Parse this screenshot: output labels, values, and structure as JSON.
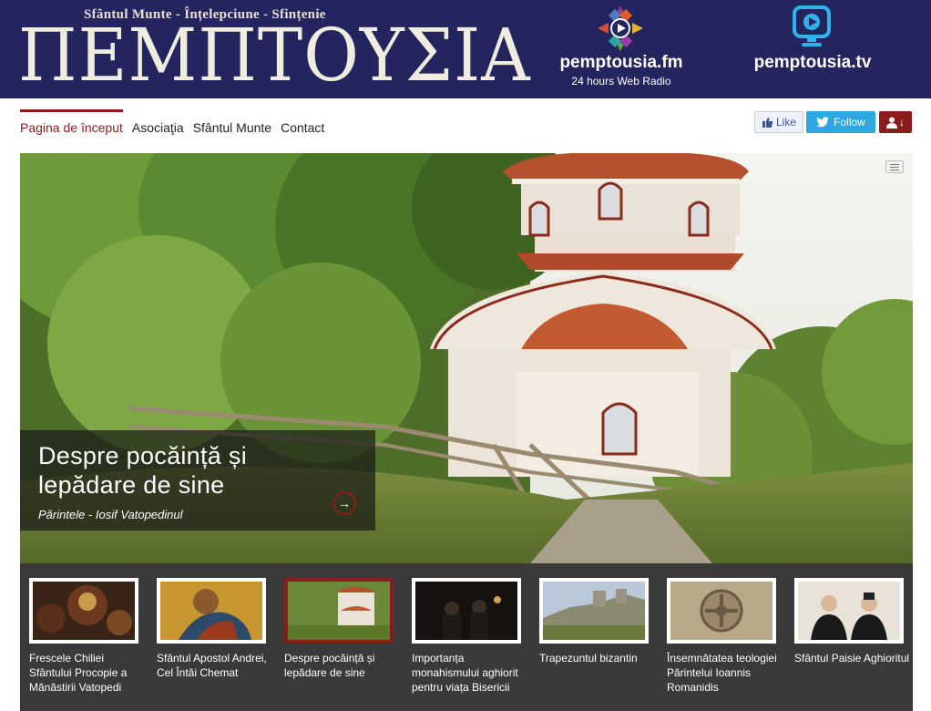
{
  "header": {
    "tagline": "Sfântul Munte - Înțelepciune - Sfințenie",
    "logo_text": "ΠΕΜΠΤΟΥΣΙΑ",
    "radio": {
      "name": "pemptousia.fm",
      "subtitle": "24 hours Web Radio",
      "icon": "radio-play-icon"
    },
    "tv": {
      "name": "pemptousia.tv",
      "icon": "tv-play-icon"
    },
    "background": "#24245e"
  },
  "nav": {
    "items": [
      {
        "label": "Pagina de început",
        "active": true
      },
      {
        "label": "Asociaţia",
        "active": false
      },
      {
        "label": "Sfântul Munte",
        "active": false
      },
      {
        "label": "Contact",
        "active": false
      }
    ],
    "accent": "#8a1c1c"
  },
  "social": {
    "like_label": "Like",
    "follow_label": "Follow",
    "user_label": "↓"
  },
  "hero": {
    "title": "Despre pocăință și lepădare de sine",
    "author": "Părintele - Iosif Vatopedinul",
    "arrow": "→"
  },
  "thumbnails": [
    {
      "label": "Frescele Chiliei Sfântului Procopie a Mănăstirii Vatopedi",
      "active": false
    },
    {
      "label": "Sfântul Apostol Andrei, Cel Întâi Chemat",
      "active": false
    },
    {
      "label": "Despre pocăință și lepădare de sine",
      "active": true
    },
    {
      "label": "Importanța monahismului aghiorit pentru viața Bisericii",
      "active": false
    },
    {
      "label": "Trapezuntul bizantin",
      "active": false
    },
    {
      "label": "Însemnătatea teologiei Părintelui Ioannis Romanidis",
      "active": false
    },
    {
      "label": "Sfântul Paisie Aghioritul",
      "active": false
    }
  ]
}
